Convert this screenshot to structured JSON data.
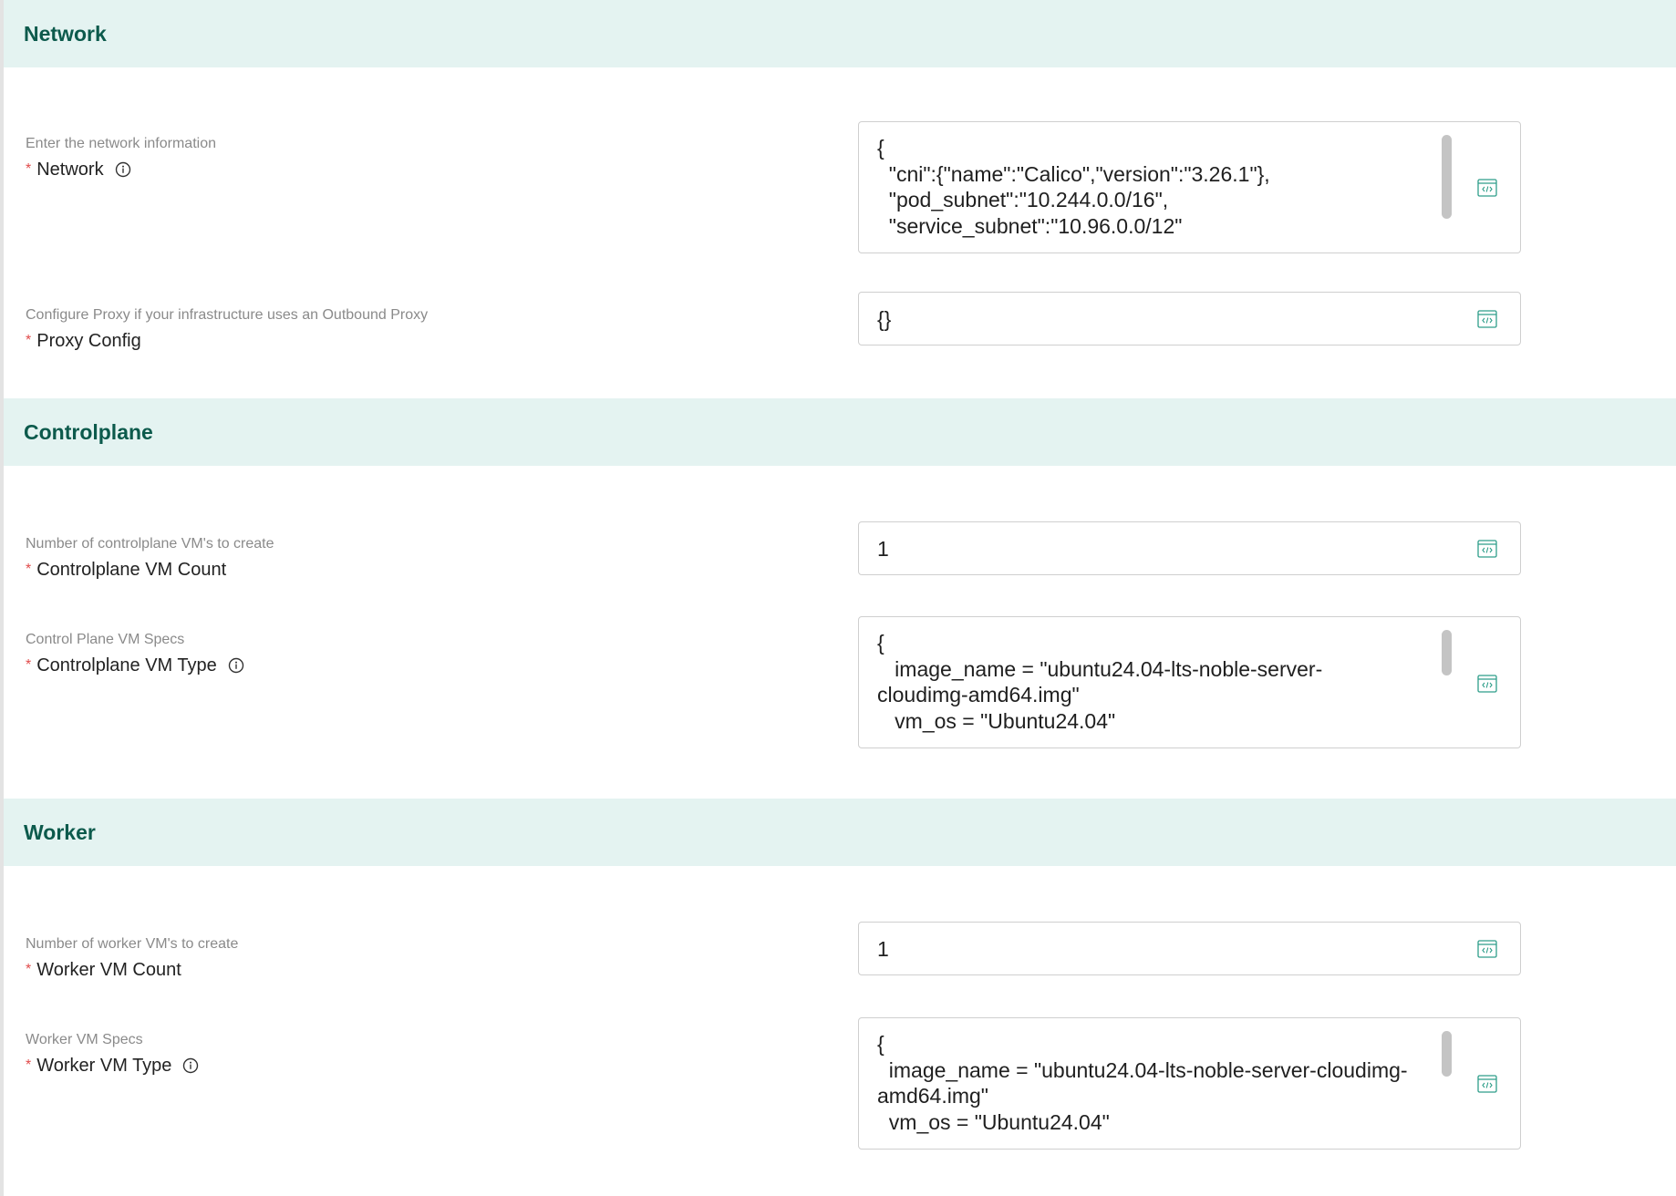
{
  "sections": [
    {
      "title": "Network",
      "fields": [
        {
          "help": "Enter the network information",
          "label": "Network",
          "value": "{\n  \"cni\":{\"name\":\"Calico\",\"version\":\"3.26.1\"},\n  \"pod_subnet\":\"10.244.0.0/16\",\n  \"service_subnet\":\"10.96.0.0/12\""
        },
        {
          "help": "Configure Proxy if your infrastructure uses an Outbound Proxy",
          "label": "Proxy Config",
          "value": "{}"
        }
      ]
    },
    {
      "title": "Controlplane",
      "fields": [
        {
          "help": "Number of controlplane VM's to create",
          "label": "Controlplane VM Count",
          "value": "1"
        },
        {
          "help": "Control Plane VM Specs",
          "label": "Controlplane VM Type",
          "value": "{\n   image_name = \"ubuntu24.04-lts-noble-server-\ncloudimg-amd64.img\"\n   vm_os = \"Ubuntu24.04\""
        }
      ]
    },
    {
      "title": "Worker",
      "fields": [
        {
          "help": "Number of worker VM's to create",
          "label": "Worker VM Count",
          "value": "1"
        },
        {
          "help": "Worker VM Specs",
          "label": "Worker VM Type",
          "value": "{\n  image_name = \"ubuntu24.04-lts-noble-server-cloudimg-\namd64.img\"\n  vm_os = \"Ubuntu24.04\""
        }
      ]
    }
  ],
  "required_marker": "*",
  "icons": {
    "info": "info-icon",
    "editor": "code-editor-icon"
  },
  "colors": {
    "section_bg": "#e4f3f1",
    "section_title": "#0c5a4c",
    "required": "#e14b4b",
    "icon": "#2f9e8a"
  }
}
